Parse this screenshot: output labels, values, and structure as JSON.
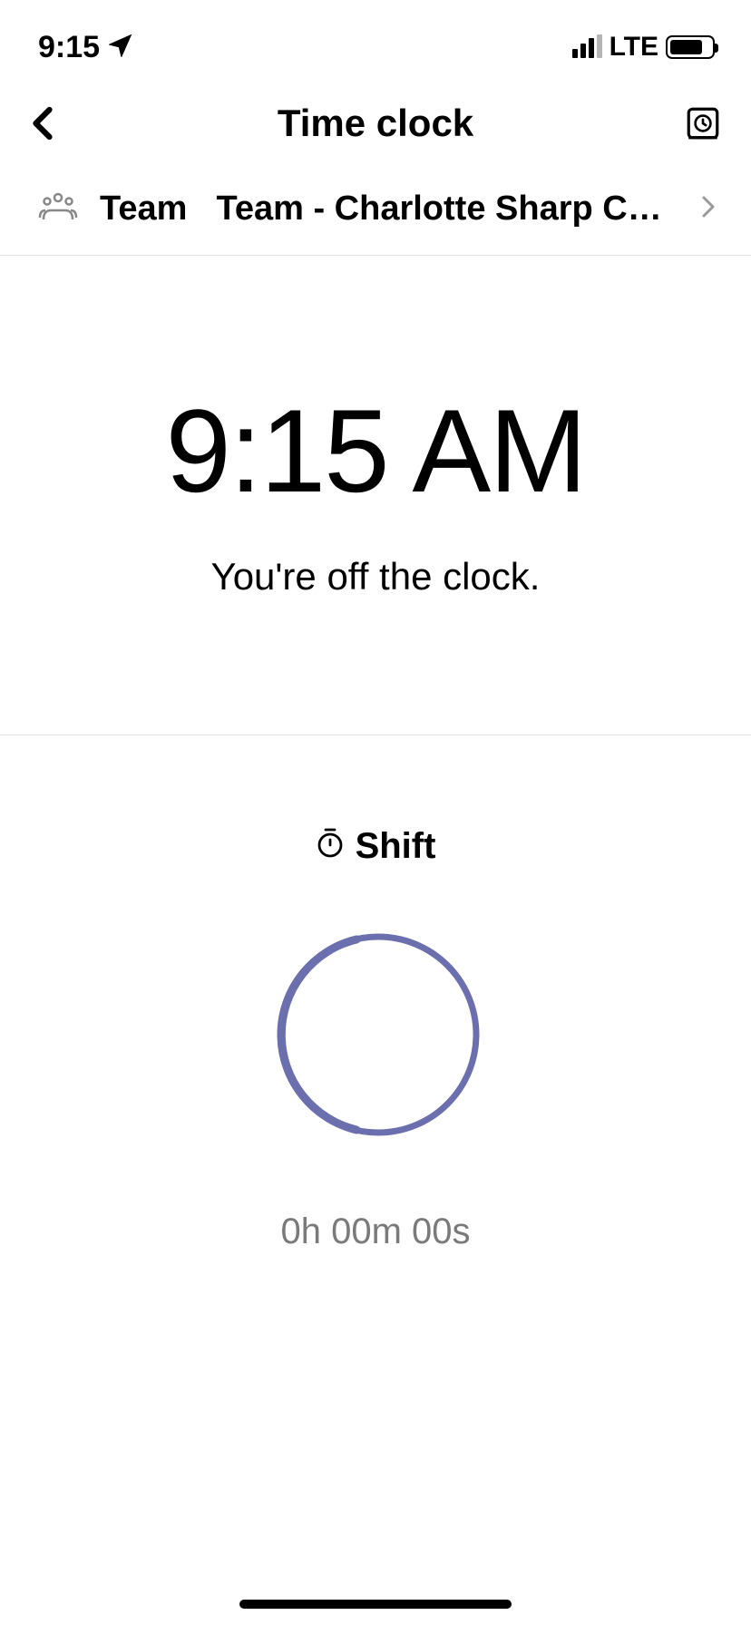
{
  "status_bar": {
    "time": "9:15",
    "network": "LTE"
  },
  "header": {
    "title": "Time clock"
  },
  "team_selector": {
    "label": "Team",
    "selected": "Team - Charlotte Sharp Children..."
  },
  "main": {
    "current_time": "9:15 AM",
    "status_message": "You're off the clock."
  },
  "shift": {
    "label": "Shift",
    "duration": "0h 00m 00s"
  },
  "colors": {
    "accent": "#6b6fae"
  }
}
